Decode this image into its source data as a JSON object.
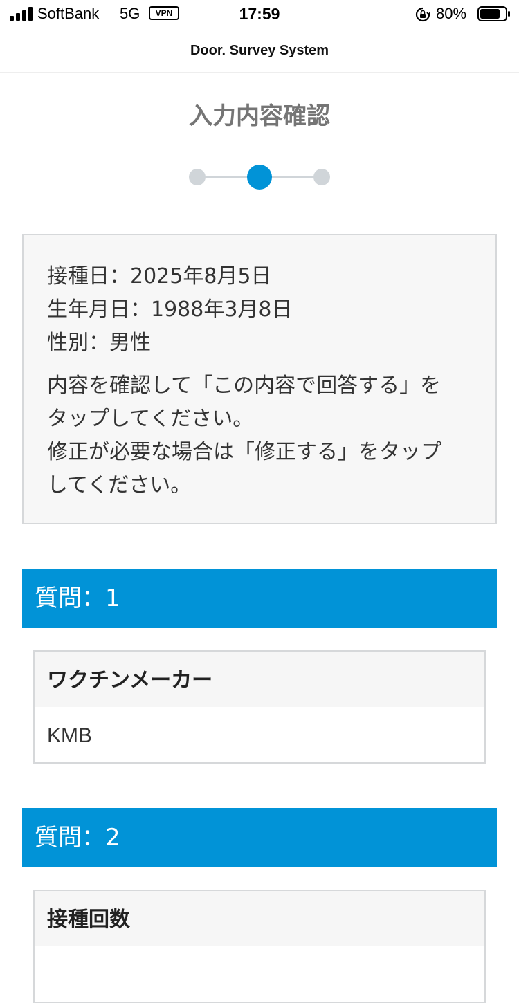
{
  "status_bar": {
    "carrier": "SoftBank",
    "network": "5G",
    "vpn": "VPN",
    "time": "17:59",
    "battery_percent": "80%",
    "battery_level": 0.8
  },
  "header": {
    "title": "Door. Survey System"
  },
  "page": {
    "title": "入力内容確認",
    "steps_total": 3,
    "current_step": 2,
    "accent_color": "#0193d7"
  },
  "summary": {
    "vaccination_date": "接種日：2025年8月5日",
    "birth_date": "生年月日：1988年3月8日",
    "gender": "性別：男性",
    "message": "内容を確認して「この内容で回答する」を\nタップしてください。\n修正が必要な場合は「修正する」をタップ\nしてください。"
  },
  "questions": [
    {
      "header": "質問：1",
      "label": "ワクチンメーカー",
      "answer": "KMB"
    },
    {
      "header": "質問：2",
      "label": "接種回数",
      "answer": ""
    }
  ]
}
